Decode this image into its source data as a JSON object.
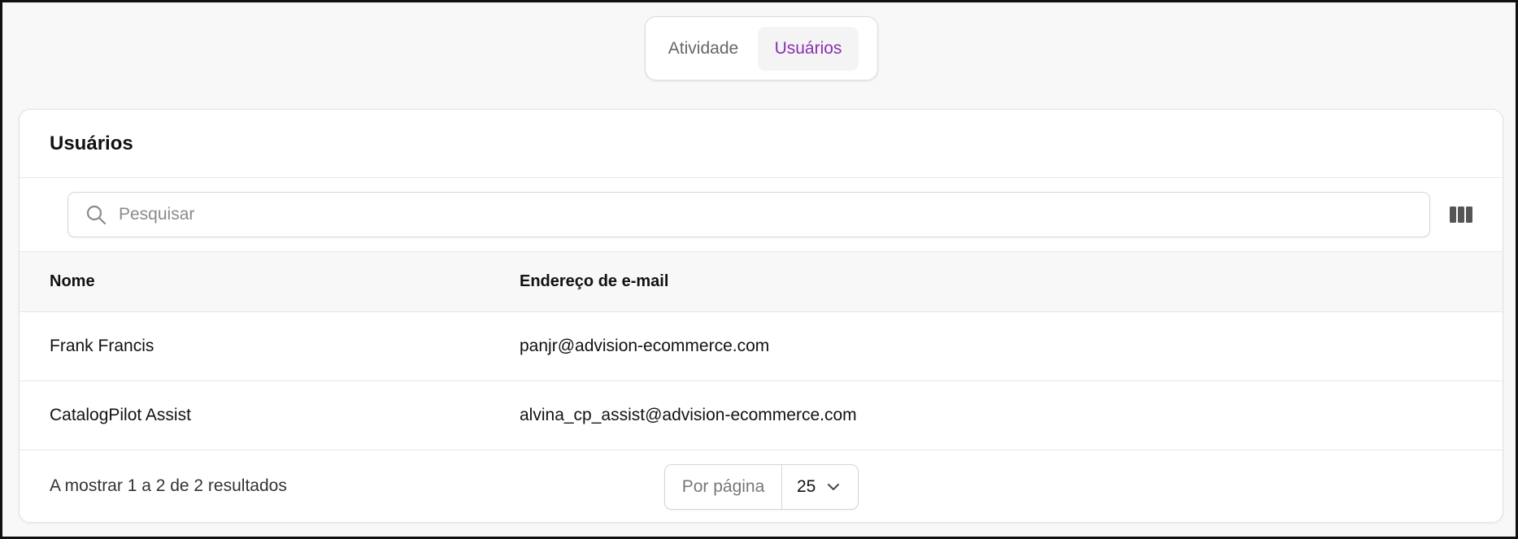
{
  "tabs": [
    {
      "label": "Atividade",
      "active": false
    },
    {
      "label": "Usuários",
      "active": true
    }
  ],
  "card": {
    "title": "Usuários"
  },
  "search": {
    "placeholder": "Pesquisar",
    "value": ""
  },
  "table": {
    "headers": [
      "Nome",
      "Endereço de e-mail"
    ],
    "rows": [
      {
        "name": "Frank Francis",
        "email": "panjr@advision-ecommerce.com"
      },
      {
        "name": "CatalogPilot Assist",
        "email": "alvina_cp_assist@advision-ecommerce.com"
      }
    ]
  },
  "pagination": {
    "summary": "A mostrar 1 a 2 de 2 resultados",
    "per_page_label": "Por página",
    "per_page_value": "25"
  },
  "icons": {
    "search": "search-icon",
    "columns": "columns-icon",
    "chevron": "chevron-down-icon"
  },
  "colors": {
    "accent": "#8a2fb0",
    "background": "#f8f8f8"
  }
}
